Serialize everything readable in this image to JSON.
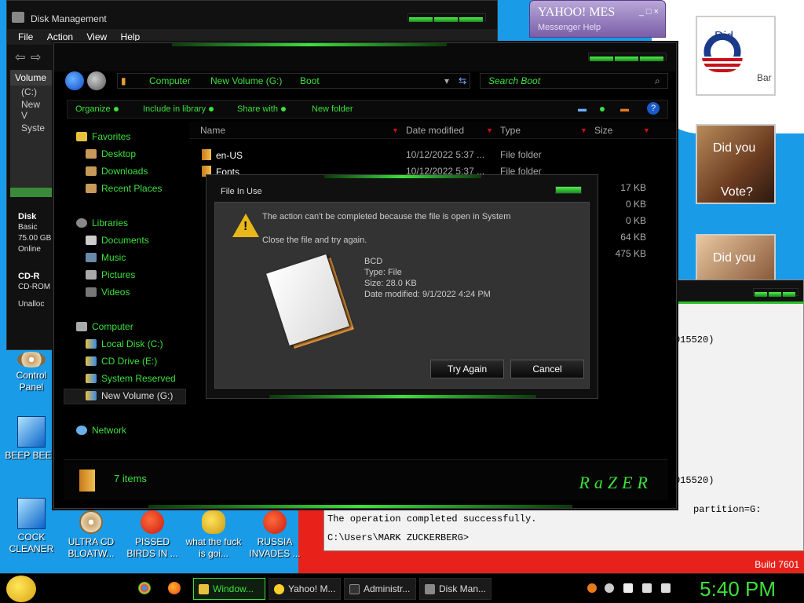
{
  "colors": {
    "accent_green": "#3ce03c",
    "desktop_blue": "#1a9be8",
    "window_black": "#000000"
  },
  "disk_management": {
    "title": "Disk Management",
    "menu": [
      "File",
      "Action",
      "View",
      "Help"
    ],
    "volume_header": "Volume",
    "volumes": [
      "(C:)",
      "New V",
      "Syste"
    ],
    "disk_label": "Disk",
    "disk_info": [
      "Basic",
      "75.00 GB",
      "Online"
    ],
    "cdrom_label": "CD-R",
    "cdrom_info": "CD-ROM",
    "unalloc": "Unalloc"
  },
  "yahoo": {
    "title": "YAHOO! MES",
    "menu": "Messenger   Help",
    "controls": "_ □ ×"
  },
  "ads": {
    "ad1_text": "Did",
    "ad1_name": "Bar",
    "ad2_line1": "Did you",
    "ad2_line2": "Vote?",
    "ad3_text": "Did you"
  },
  "explorer": {
    "breadcrumb": [
      "Computer",
      "New Volume (G:)",
      "Boot"
    ],
    "search_placeholder": "Search Boot",
    "toolbar": [
      "Organize",
      "Include in library",
      "Share with",
      "New folder"
    ],
    "nav": {
      "favorites": "Favorites",
      "fav_items": [
        "Desktop",
        "Downloads",
        "Recent Places"
      ],
      "libraries": "Libraries",
      "lib_items": [
        "Documents",
        "Music",
        "Pictures",
        "Videos"
      ],
      "computer": "Computer",
      "comp_items": [
        "Local Disk (C:)",
        "CD Drive (E:)",
        "System Reserved",
        "New Volume (G:)"
      ],
      "network": "Network"
    },
    "columns": [
      "Name",
      "Date modified",
      "Type",
      "Size"
    ],
    "rows": [
      {
        "name": "en-US",
        "date": "10/12/2022 5:37 ...",
        "type": "File folder",
        "size": ""
      },
      {
        "name": "Fonts",
        "date": "10/12/2022 5:37 ...",
        "type": "File folder",
        "size": ""
      }
    ],
    "sizes": [
      "17 KB",
      "0 KB",
      "0 KB",
      "64 KB",
      "475 KB"
    ],
    "status": "7 items",
    "brand": "RaZER"
  },
  "dialog": {
    "title": "File In Use",
    "message": "The action can't be completed because the file is open in System",
    "instruction": "Close the file and try again.",
    "file_name": "BCD",
    "file_type": "Type: File",
    "file_size": "Size: 28.0 KB",
    "file_date": "Date modified: 9/1/2022 4:24 PM",
    "try_again": "Try Again",
    "cancel": "Cancel"
  },
  "cmd": {
    "line_a": "015520)",
    "line_b": "015520)",
    "line_c": "partition=G:",
    "line_d": "The operation completed successfully.",
    "prompt": "C:\\Users\\MARK ZUCKERBERG>",
    "build_text": "Build 7601"
  },
  "desktop_icons": [
    {
      "label": "Control Panel"
    },
    {
      "label": "BEEP BEEP"
    },
    {
      "label": "COCK CLEANER"
    },
    {
      "label": "ULTRA CD BLOATW..."
    },
    {
      "label": "PISSED BIRDS IN ..."
    },
    {
      "label": "what the fuck is goi..."
    },
    {
      "label": "RUSSIA INVADES ..."
    }
  ],
  "taskbar": {
    "tasks": [
      "Window...",
      "Yahoo! M...",
      "Administr...",
      "Disk Man..."
    ],
    "clock": "5:40 PM"
  }
}
